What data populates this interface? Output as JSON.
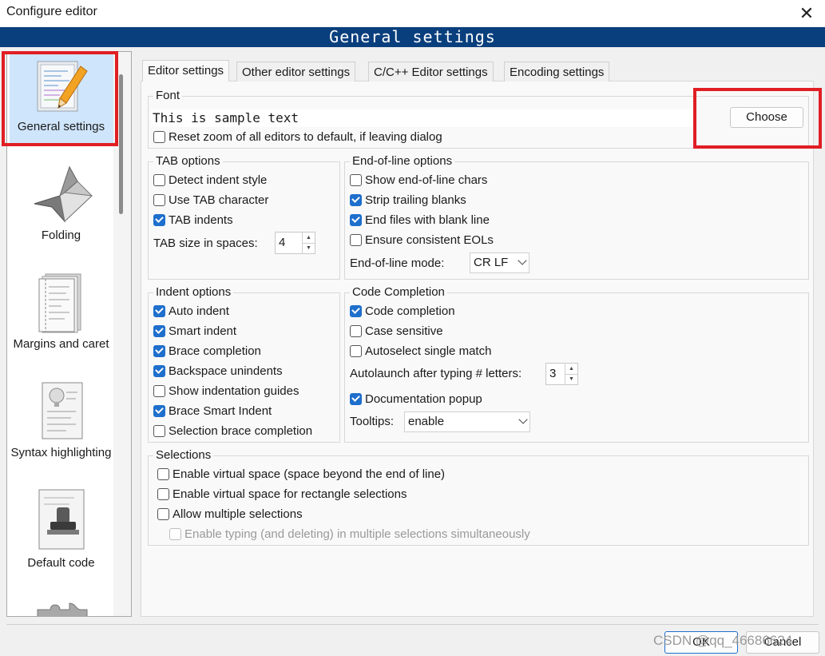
{
  "window": {
    "title": "Configure editor"
  },
  "header": {
    "title": "General settings"
  },
  "sidebar": {
    "items": [
      {
        "label": "General settings",
        "icon": "notepad-pencil-icon",
        "selected": true
      },
      {
        "label": "Folding",
        "icon": "origami-bird-icon"
      },
      {
        "label": "Margins and caret",
        "icon": "document-margins-icon"
      },
      {
        "label": "Syntax highlighting",
        "icon": "document-lightbulb-icon"
      },
      {
        "label": "Default code",
        "icon": "rubber-stamp-icon"
      }
    ]
  },
  "tabs": [
    "Editor settings",
    "Other editor settings",
    "C/C++ Editor settings",
    "Encoding settings"
  ],
  "font": {
    "title": "Font",
    "sample": "This is sample text",
    "choose_label": "Choose",
    "reset_zoom": {
      "label": "Reset zoom of all editors to default, if leaving dialog",
      "checked": false
    }
  },
  "tab_options": {
    "title": "TAB options",
    "detect": {
      "label": "Detect indent style",
      "checked": false
    },
    "use_tab": {
      "label": "Use TAB character",
      "checked": false
    },
    "tab_indents": {
      "label": "TAB indents",
      "checked": true
    },
    "size_label": "TAB size in spaces:",
    "size_value": "4"
  },
  "eol_options": {
    "title": "End-of-line options",
    "show_eol": {
      "label": "Show end-of-line chars",
      "checked": false
    },
    "strip": {
      "label": "Strip trailing blanks",
      "checked": true
    },
    "end_blank": {
      "label": "End files with blank line",
      "checked": true
    },
    "consistent": {
      "label": "Ensure consistent EOLs",
      "checked": false
    },
    "mode_label": "End-of-line mode:",
    "mode_value": "CR LF"
  },
  "indent_options": {
    "title": "Indent options",
    "auto": {
      "label": "Auto indent",
      "checked": true
    },
    "smart": {
      "label": "Smart indent",
      "checked": true
    },
    "brace": {
      "label": "Brace completion",
      "checked": true
    },
    "backspace": {
      "label": "Backspace unindents",
      "checked": true
    },
    "guides": {
      "label": "Show indentation guides",
      "checked": false
    },
    "brace_smart": {
      "label": "Brace Smart Indent",
      "checked": true
    },
    "selection_brace": {
      "label": "Selection brace completion",
      "checked": false
    }
  },
  "code_completion": {
    "title": "Code Completion",
    "enabled": {
      "label": "Code completion",
      "checked": true
    },
    "case": {
      "label": "Case sensitive",
      "checked": false
    },
    "autoselect": {
      "label": "Autoselect single match",
      "checked": false
    },
    "autolaunch_label": "Autolaunch after typing # letters:",
    "autolaunch_value": "3",
    "doc_popup": {
      "label": "Documentation popup",
      "checked": true
    },
    "tooltips_label": "Tooltips:",
    "tooltips_value": "enable"
  },
  "selections": {
    "title": "Selections",
    "virtual": {
      "label": "Enable virtual space (space beyond the end of line)",
      "checked": false
    },
    "virtual_rect": {
      "label": "Enable virtual space for rectangle selections",
      "checked": false
    },
    "multiple": {
      "label": "Allow multiple selections",
      "checked": false
    },
    "typing_multi": {
      "label": "Enable typing (and deleting) in multiple selections simultaneously",
      "checked": false,
      "disabled": true
    }
  },
  "footer": {
    "ok_label": "OK",
    "cancel_label": "Cancel"
  },
  "watermark": "CSDN @qq_46686624",
  "colors": {
    "header": "#0a3f7d",
    "highlight": "#e01e24",
    "check": "#1f6fcc"
  }
}
